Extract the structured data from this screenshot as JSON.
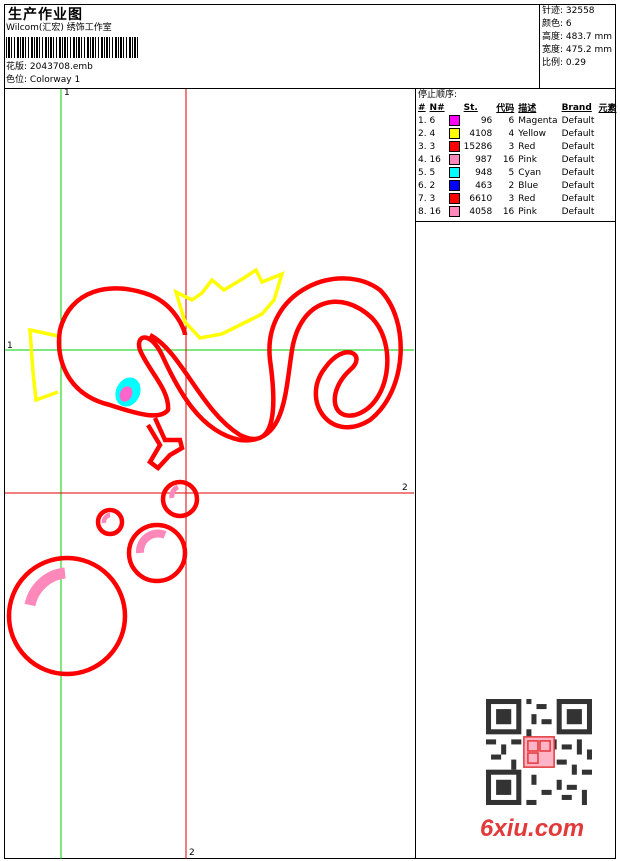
{
  "header": {
    "title": "生产作业图",
    "company": "Wilcom(汇宏) 绣饰工作室",
    "design_label": "花版:",
    "design_value": "2043708.emb",
    "colorway_label": "色位:",
    "colorway_value": "Colorway 1"
  },
  "stats": {
    "stitches": "针迹: 32558",
    "colors": "颜色: 6",
    "height": "高度: 483.7 mm",
    "width": "宽度: 475.2 mm",
    "scale": "比例: 0.29"
  },
  "sequence": {
    "title": "停止顺序:",
    "headers": [
      "#",
      "N#",
      "St.",
      "代码",
      "描述",
      "Brand",
      "元素"
    ],
    "rows": [
      {
        "idx": "1. 6",
        "color": "#ff00ff",
        "st": "96",
        "code": "6",
        "desc": "Magenta",
        "brand": "Default"
      },
      {
        "idx": "2. 4",
        "color": "#ffff00",
        "st": "4108",
        "code": "4",
        "desc": "Yellow",
        "brand": "Default"
      },
      {
        "idx": "3. 3",
        "color": "#ff0000",
        "st": "15286",
        "code": "3",
        "desc": "Red",
        "brand": "Default"
      },
      {
        "idx": "4. 16",
        "color": "#ff88bb",
        "st": "987",
        "code": "16",
        "desc": "Pink",
        "brand": "Default"
      },
      {
        "idx": "5. 5",
        "color": "#00ffff",
        "st": "948",
        "code": "5",
        "desc": "Cyan",
        "brand": "Default"
      },
      {
        "idx": "6. 2",
        "color": "#0000ff",
        "st": "463",
        "code": "2",
        "desc": "Blue",
        "brand": "Default"
      },
      {
        "idx": "7. 3",
        "color": "#ff0000",
        "st": "6610",
        "code": "3",
        "desc": "Red",
        "brand": "Default"
      },
      {
        "idx": "8. 16",
        "color": "#ff88bb",
        "st": "4058",
        "code": "16",
        "desc": "Pink",
        "brand": "Default"
      }
    ]
  },
  "guides": {
    "v1": "1",
    "h1": "1",
    "v2": "2",
    "h2": "2"
  },
  "watermark": {
    "brand": "6xiu.com"
  },
  "colors": {
    "guide_green": "#00cc00",
    "guide_red": "#dd0000",
    "thread_red": "#ff0000",
    "thread_yellow": "#ffff00",
    "thread_pink": "#ff88bb",
    "thread_cyan": "#00ffff"
  }
}
